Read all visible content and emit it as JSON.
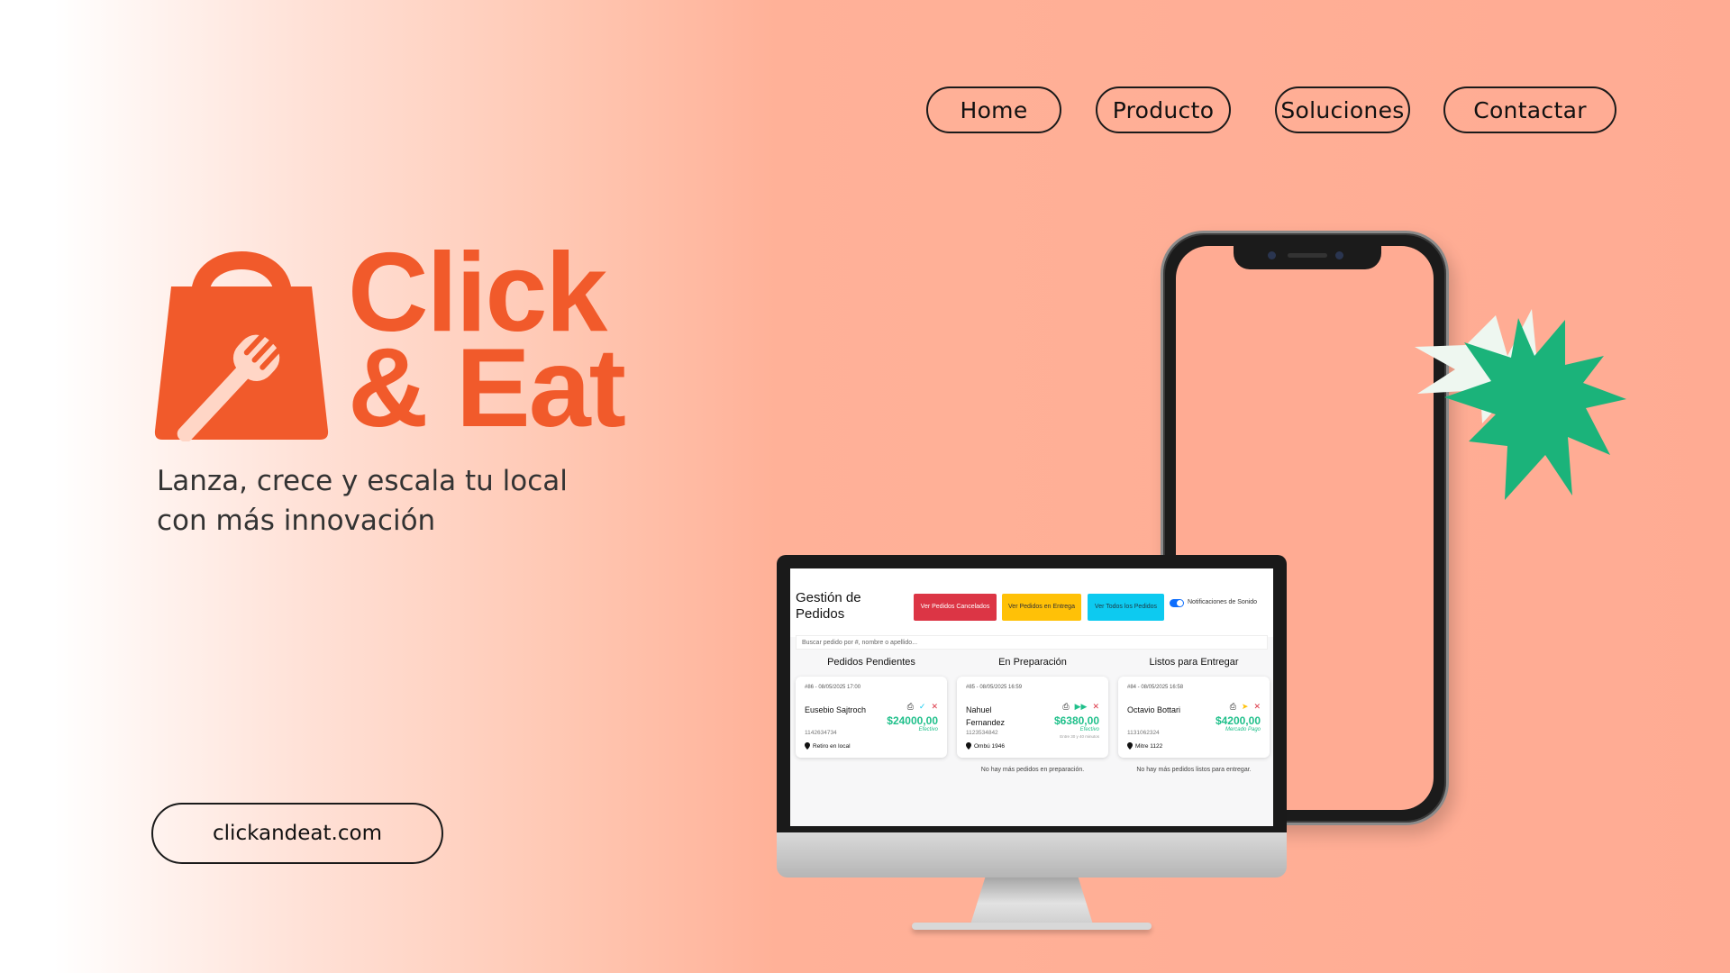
{
  "nav": {
    "home": "Home",
    "producto": "Producto",
    "soluciones": "Soluciones",
    "contactar": "Contactar"
  },
  "brand": {
    "line1": "Click",
    "line2": "& Eat",
    "tagline": "Lanza, crece y escala tu local con más innovación",
    "website": "clickandeat.com",
    "color": "#f15a2b",
    "accent_green": "#1bb37a"
  },
  "app": {
    "title": "Gestión de Pedidos",
    "buttons": {
      "cancelados": "Ver Pedidos Cancelados",
      "entrega": "Ver Pedidos en Entrega",
      "todos": "Ver Todos los Pedidos"
    },
    "notifications": "Notificaciones de Sonido",
    "search_placeholder": "Buscar pedido por #, nombre o apellido...",
    "columns": [
      {
        "title": "Pedidos Pendientes",
        "card": {
          "header": "#86 - 08/05/2025 17:00",
          "name": "Eusebio Sajtroch",
          "phone": "1142634734",
          "location": "Retiro en local",
          "amount": "$24000,00",
          "method": "Efectivo",
          "extra": ""
        },
        "empty": ""
      },
      {
        "title": "En Preparación",
        "card": {
          "header": "#85 - 08/05/2025 16:59",
          "name": "Nahuel Fernandez",
          "phone": "1123534842",
          "location": "Ombú 1946",
          "amount": "$6380,00",
          "method": "Efectivo",
          "extra": "Entre 30 y 40 minutos"
        },
        "empty": "No hay más pedidos en preparación."
      },
      {
        "title": "Listos para Entregar",
        "card": {
          "header": "#84 - 08/05/2025 16:58",
          "name": "Octavio Bottari",
          "phone": "1131062324",
          "location": "Mitre 1122",
          "amount": "$4200,00",
          "method": "Mercado Pago",
          "extra": ""
        },
        "empty": "No hay más pedidos listos para entregar."
      }
    ]
  }
}
